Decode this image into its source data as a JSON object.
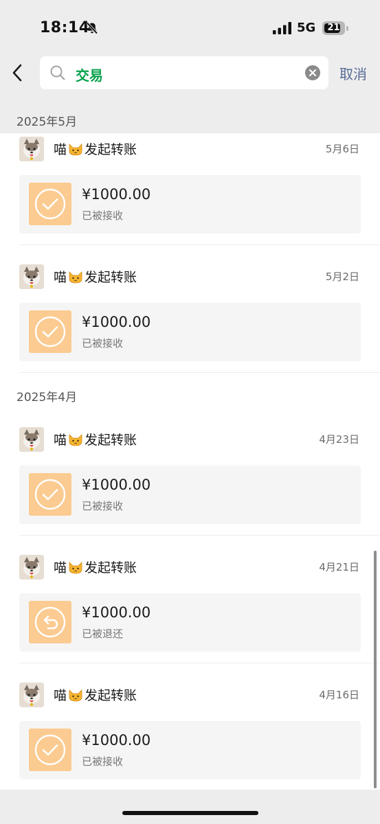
{
  "status_bar": {
    "time": "18:14",
    "network": "5G",
    "battery": "21",
    "icons": [
      "bell-slash-icon",
      "signal-bars-icon",
      "battery-icon"
    ]
  },
  "search": {
    "query": "交易",
    "cancel_label": "取消",
    "icons": [
      "back-chevron-icon",
      "search-icon",
      "clear-icon"
    ]
  },
  "sections": [
    {
      "header": "2025年5月",
      "items": [
        {
          "sender": "喵",
          "action": "发起转账",
          "date": "5月6日",
          "amount": "¥1000.00",
          "status": "已被接收",
          "status_icon": "check-circle-icon"
        },
        {
          "sender": "喵",
          "action": "发起转账",
          "date": "5月2日",
          "amount": "¥1000.00",
          "status": "已被接收",
          "status_icon": "check-circle-icon"
        }
      ]
    },
    {
      "header": "2025年4月",
      "items": [
        {
          "sender": "喵",
          "action": "发起转账",
          "date": "4月23日",
          "amount": "¥1000.00",
          "status": "已被接收",
          "status_icon": "check-circle-icon"
        },
        {
          "sender": "喵",
          "action": "发起转账",
          "date": "4月21日",
          "amount": "¥1000.00",
          "status": "已被退还",
          "status_icon": "return-circle-icon"
        },
        {
          "sender": "喵",
          "action": "发起转账",
          "date": "4月16日",
          "amount": "¥1000.00",
          "status": "已被接收",
          "status_icon": "check-circle-icon"
        }
      ]
    }
  ],
  "colors": {
    "accent_green": "#07a14c",
    "link_blue": "#576b95",
    "transfer_orange": "#fbcb91",
    "background_gray": "#ededed"
  }
}
